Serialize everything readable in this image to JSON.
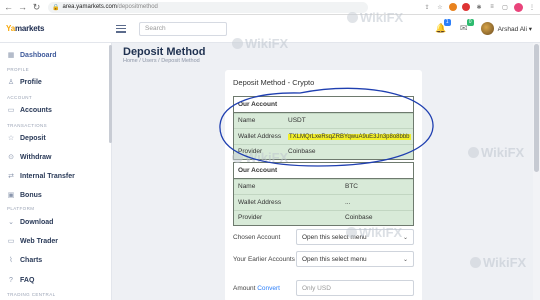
{
  "browser": {
    "url_host": "area.yamarkets.com",
    "url_path": "/depositmethod"
  },
  "header": {
    "logo_prefix": "Ya",
    "logo_rest": "markets",
    "search_placeholder": "Search",
    "notif_count": "1",
    "message_count": "0",
    "user_name": "Arshad Ali ▾"
  },
  "sidebar": {
    "items": [
      {
        "label": "Dashboard"
      },
      {
        "label": "Profile"
      },
      {
        "label": "Accounts"
      },
      {
        "label": "Deposit"
      },
      {
        "label": "Withdraw"
      },
      {
        "label": "Internal Transfer"
      },
      {
        "label": "Bonus"
      },
      {
        "label": "Download"
      },
      {
        "label": "Web Trader"
      },
      {
        "label": "Charts"
      },
      {
        "label": "FAQ"
      }
    ],
    "sections": {
      "profile": "PROFILE",
      "account": "ACCOUNT",
      "transactions": "TRANSACTIONS",
      "platform": "PLATFORM",
      "trading_central": "TRADING CENTRAL"
    }
  },
  "main": {
    "title": "Deposit Method",
    "breadcrumb": "Home  /  Users  /  Deposit Method",
    "card_title": "Deposit Method - Crypto",
    "account1": {
      "header": "Our Account",
      "rows": [
        {
          "label": "Name",
          "value": "USDT"
        },
        {
          "label": "Wallet Address",
          "value": "TXLMQrLxeRsqZRBYqwuA9uE3Jn3p8o8bbb"
        },
        {
          "label": "Provider",
          "value": "Coinbase"
        }
      ]
    },
    "account2": {
      "header": "Our Account",
      "rows": [
        {
          "label": "Name",
          "value": "BTC"
        },
        {
          "label": "Wallet Address",
          "value": "..."
        },
        {
          "label": "Provider",
          "value": "Coinbase"
        }
      ]
    },
    "form": {
      "chosen_account_label": "Chosen Account",
      "chosen_account_value": "Open this select menu",
      "your_earlier_label": "Your Earlier Accounts",
      "your_earlier_value": "Open this select menu",
      "amount_label": "Amount",
      "convert_label": "Convert",
      "amount_placeholder": "Only USD"
    }
  },
  "watermark": "WikiFX",
  "colors": {
    "highlight": "#f2ef2a",
    "table_bg": "#d8ead8",
    "annotation": "#1f3fb0",
    "accent": "#2d7ff9"
  }
}
